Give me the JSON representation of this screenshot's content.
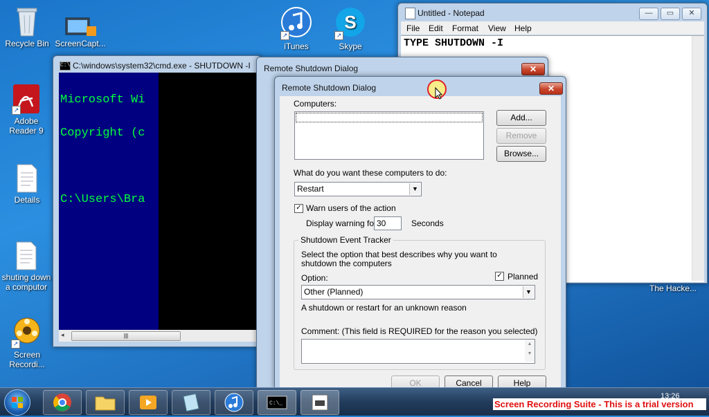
{
  "desktop": {
    "icons": [
      {
        "label": "Recycle Bin"
      },
      {
        "label": "ScreenCapt..."
      },
      {
        "label": "iTunes"
      },
      {
        "label": "Skype"
      },
      {
        "label": "Adobe Reader 9"
      },
      {
        "label": "Details"
      },
      {
        "label": "shuting down a computor"
      },
      {
        "label": "Screen Recordi..."
      },
      {
        "label": "The Hacke..."
      }
    ]
  },
  "notepad": {
    "title": "Untitled - Notepad",
    "menu": [
      "File",
      "Edit",
      "Format",
      "View",
      "Help"
    ],
    "content": "TYPE SHUTDOWN -I"
  },
  "cmd": {
    "title": "C:\\windows\\system32\\cmd.exe - SHUTDOWN  -I",
    "lines": [
      "Microsoft Wi",
      "Copyright (c",
      "",
      "C:\\Users\\Bra"
    ]
  },
  "back_dialog": {
    "title": "Remote Shutdown Dialog"
  },
  "dialog": {
    "title": "Remote Shutdown Dialog",
    "computers_label": "Computers:",
    "add_button": "Add...",
    "remove_button": "Remove",
    "browse_button": "Browse...",
    "action_label": "What do you want these computers to do:",
    "action_value": "Restart",
    "warn_label": "Warn users of the action",
    "warn_checked": true,
    "display_warning_label": "Display warning for",
    "display_warning_value": "30",
    "seconds_label": "Seconds",
    "tracker_legend": "Shutdown Event Tracker",
    "tracker_desc": "Select the option that best describes why you want to shutdown the computers",
    "option_label": "Option:",
    "planned_label": "Planned",
    "planned_checked": true,
    "option_value": "Other (Planned)",
    "reason_text": "A shutdown or restart for an unknown reason",
    "comment_label": "Comment: (This field is REQUIRED for the reason you selected)",
    "comment_value": "",
    "ok_button": "OK",
    "cancel_button": "Cancel",
    "help_button": "Help"
  },
  "taskbar": {
    "clock_time": "13:26",
    "watermark": "Screen Recording Suite - This is a trial version"
  }
}
